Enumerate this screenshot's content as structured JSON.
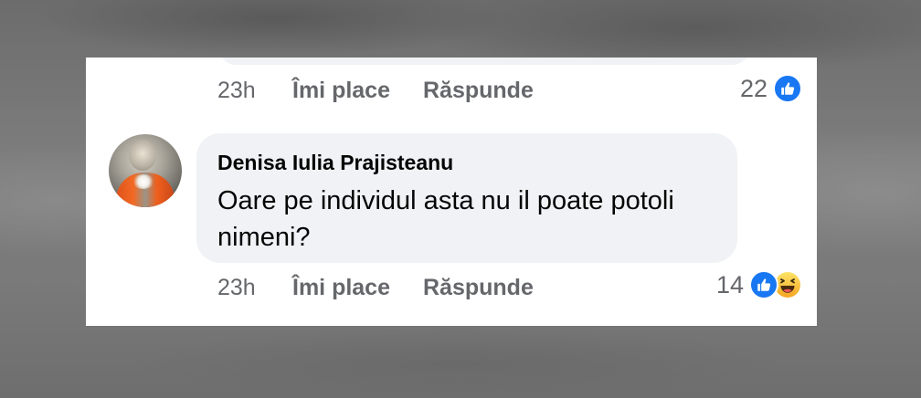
{
  "comments": [
    {
      "time": "23h",
      "like_label": "Îmi place",
      "reply_label": "Răspunde",
      "reaction_count": "22",
      "reaction_icons": [
        "like-icon"
      ]
    },
    {
      "author": "Denisa Iulia Prajisteanu",
      "text": "Oare pe individul asta nu il poate potoli nimeni?",
      "time": "23h",
      "like_label": "Îmi place",
      "reply_label": "Răspunde",
      "reaction_count": "14",
      "reaction_icons": [
        "like-icon",
        "haha-icon"
      ]
    }
  ],
  "colors": {
    "like_blue": "#1877f2",
    "haha_yellow": "#f7b125",
    "meta_gray": "#65676b",
    "bubble_bg": "#f0f2f5"
  }
}
